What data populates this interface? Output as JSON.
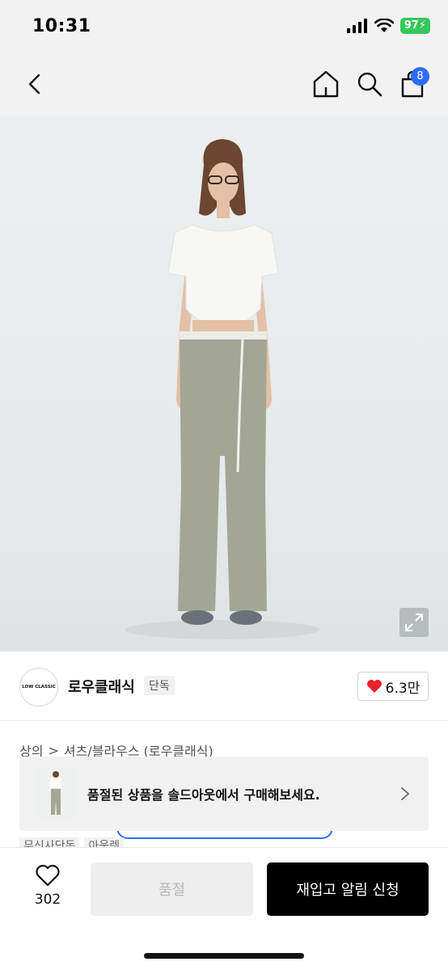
{
  "status_bar": {
    "time": "10:31",
    "battery": "97",
    "icons": [
      "signal-icon",
      "wifi-icon",
      "battery-icon"
    ]
  },
  "nav": {
    "icons": [
      "back-icon",
      "home-icon",
      "search-icon",
      "shopping-bag-icon"
    ],
    "cart_badge": "8"
  },
  "product_image": {
    "icon": "expand-icon"
  },
  "brand": {
    "logo_text": "LOW CLASSIC",
    "name": "로우클래식",
    "tag": "단독",
    "likes": "6.3만"
  },
  "category": {
    "parent": "상의",
    "separator": ">",
    "child": "셔츠/블라우스 (로우클래식)"
  },
  "soldout_banner": {
    "text": "품절된 상품을 솔드아웃에서 구매해보세요."
  },
  "peek_tags": [
    "무신사단독",
    "아웃렛"
  ],
  "bottom_bar": {
    "wish_count": "302",
    "soldout_label": "품절",
    "restock_label": "재입고 알림 신청"
  },
  "colors": {
    "accent": "#2f6bff",
    "heart": "#e8212b",
    "battery": "#34c759",
    "primary_button": "#000000",
    "disabled_button": "#eeeeee"
  }
}
